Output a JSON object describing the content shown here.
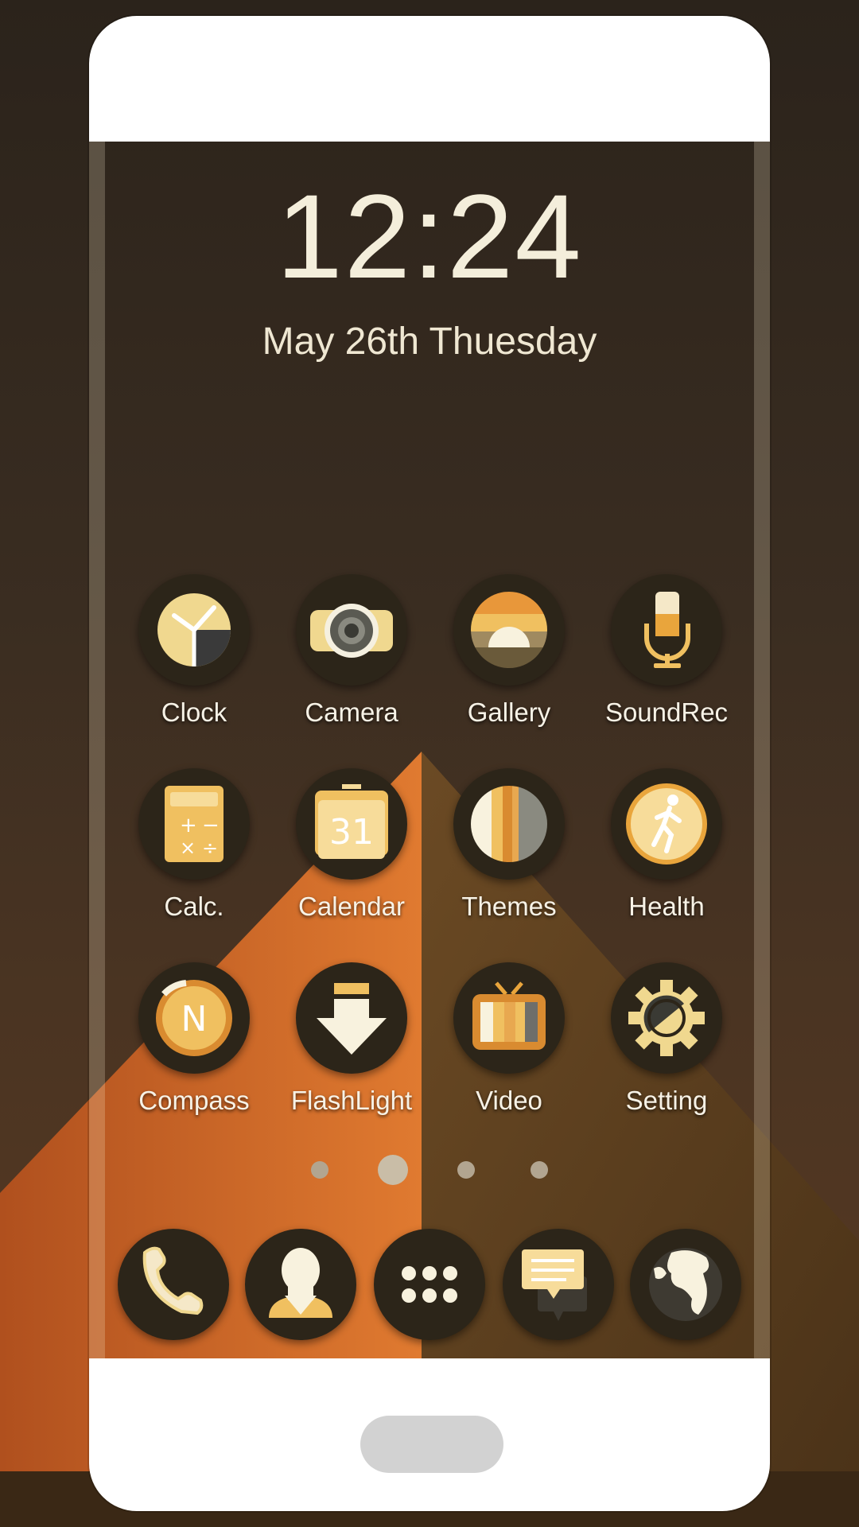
{
  "status": {
    "time": "12:24",
    "date": "May 26th Thuesday"
  },
  "apps": [
    {
      "label": "Clock",
      "icon": "clock-icon"
    },
    {
      "label": "Camera",
      "icon": "camera-icon"
    },
    {
      "label": "Gallery",
      "icon": "gallery-icon"
    },
    {
      "label": "SoundRec",
      "icon": "microphone-icon"
    },
    {
      "label": "Calc.",
      "icon": "calculator-icon"
    },
    {
      "label": "Calendar",
      "icon": "calendar-icon",
      "badge": "31"
    },
    {
      "label": "Themes",
      "icon": "themes-icon"
    },
    {
      "label": "Health",
      "icon": "runner-icon"
    },
    {
      "label": "Compass",
      "icon": "compass-icon",
      "badge": "N"
    },
    {
      "label": "FlashLight",
      "icon": "flashlight-icon"
    },
    {
      "label": "Video",
      "icon": "tv-icon"
    },
    {
      "label": "Setting",
      "icon": "gear-icon"
    }
  ],
  "dock": [
    {
      "icon": "phone-icon"
    },
    {
      "icon": "contacts-icon"
    },
    {
      "icon": "app-drawer-icon"
    },
    {
      "icon": "messages-icon"
    },
    {
      "icon": "globe-icon"
    }
  ],
  "pager": {
    "pages": 4,
    "current": 2
  },
  "colors": {
    "accent": "#f0c060",
    "icon_bg": "#2c2519",
    "text": "#f7f2e6"
  }
}
